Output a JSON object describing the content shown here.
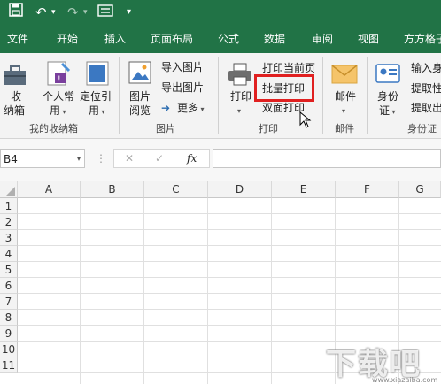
{
  "qat": {
    "save": "save-icon",
    "undo": "undo-icon",
    "redo": "redo-icon",
    "form": "form-icon",
    "more": "▾"
  },
  "tabs": [
    "文件",
    "开始",
    "插入",
    "页面布局",
    "公式",
    "数据",
    "审阅",
    "视图",
    "方方格子"
  ],
  "ribbon": {
    "collection": {
      "btn1": "收",
      "btn1b": "纳箱",
      "btn2": "个人常",
      "btn2b": "用",
      "btn3": "定位引",
      "btn3b": "用",
      "label": "我的收纳箱"
    },
    "pictures": {
      "view1": "图片",
      "view2": "阅览",
      "import": "导入图片",
      "export": "导出图片",
      "more": "更多",
      "label": "图片"
    },
    "print": {
      "print": "打印",
      "current": "打印当前页",
      "batch": "批量打印",
      "duplex": "双面打印",
      "label": "打印"
    },
    "mail": {
      "mail": "邮件",
      "label": "邮件"
    },
    "idcard": {
      "id1": "身份",
      "id2": "证",
      "input": "输入身",
      "extract1": "提取性",
      "extract2": "提取出",
      "label": "身份证"
    }
  },
  "formula": {
    "cell_ref": "B4",
    "fx": "fx",
    "cancel": "✕",
    "confirm": "✓"
  },
  "columns": [
    "A",
    "B",
    "C",
    "D",
    "E",
    "F",
    "G"
  ],
  "rows": [
    "1",
    "2",
    "3",
    "4",
    "5",
    "6",
    "7",
    "8",
    "9",
    "10",
    "11"
  ],
  "watermark": {
    "text": "下载吧",
    "url": "www.xiazaiba.com"
  },
  "colors": {
    "accent": "#217346",
    "highlight": "#e02020"
  }
}
